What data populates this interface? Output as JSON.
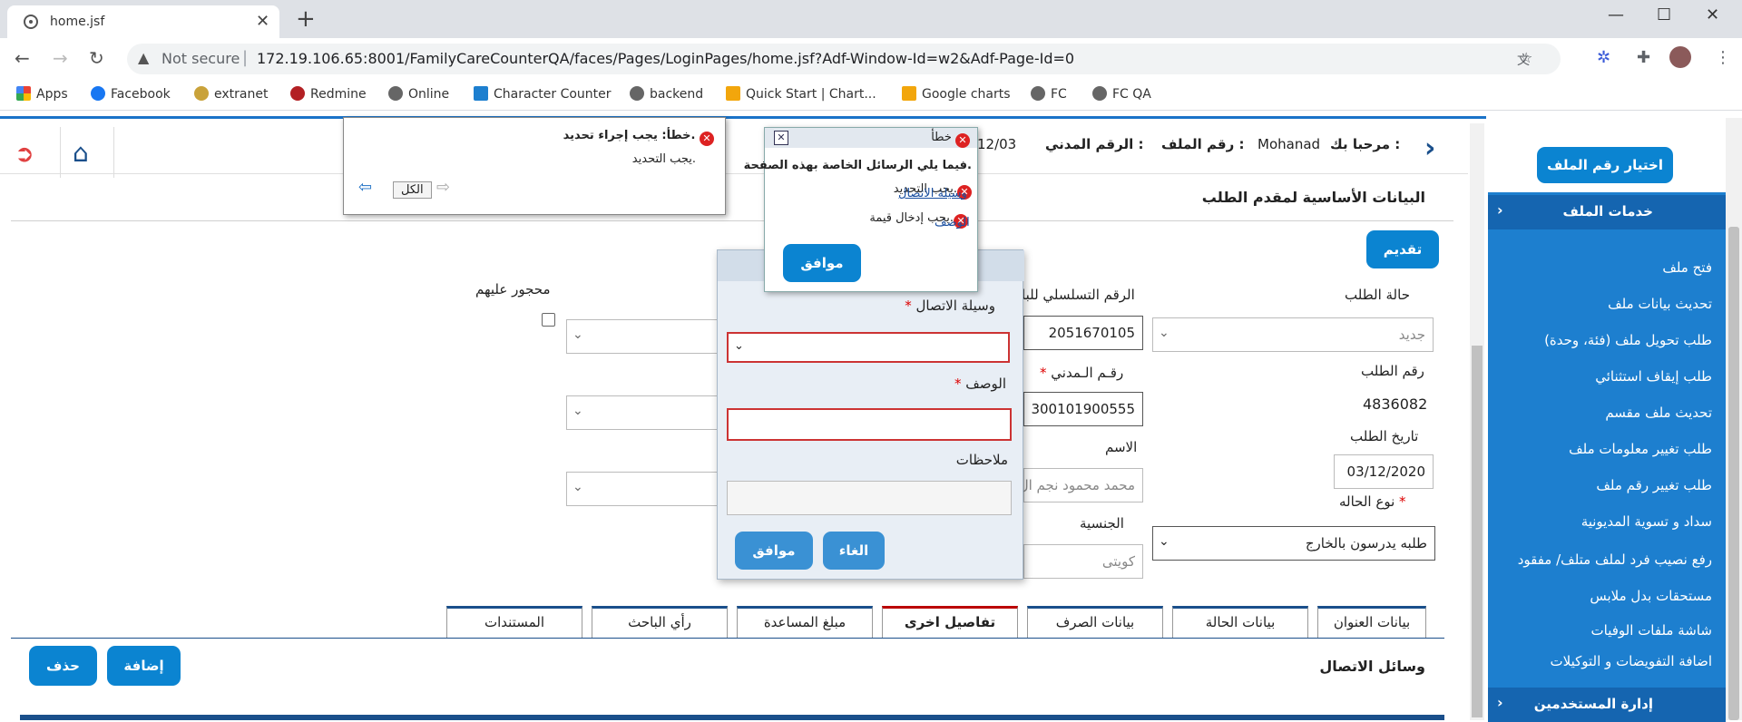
{
  "browser": {
    "tab_title": "home.jsf",
    "not_secure": "Not secure",
    "url": "172.19.106.65:8001/FamilyCareCounterQA/faces/Pages/LoginPages/home.jsf?Adf-Window-Id=w2&Adf-Page-Id=0",
    "bookmarks": [
      "Apps",
      "Facebook",
      "extranet",
      "Redmine",
      "Online",
      "Character Counter",
      "backend",
      "Quick Start | Chart...",
      "Google charts",
      "FC",
      "FC QA"
    ]
  },
  "header": {
    "welcome": "مرحبا بك :",
    "user": "Mohanad",
    "file_no_label": "رقم الملف :",
    "civil_no_label": "الرقم المدني :",
    "date_fragment": "12/03"
  },
  "sidebar": {
    "choose_file": "اختيار رقم الملف",
    "section1": "خدمات الملف",
    "items": [
      "فتح ملف",
      "تحديث بيانات ملف",
      "طلب تحويل ملف (فئة، وحدة)",
      "طلب إيقاف استثنائي",
      "تحديث ملف مقسم",
      "طلب تغيير معلومات ملف",
      "طلب تغيير رقم ملف",
      "سداد و تسوية المديونية",
      "رفع نصيب فرد لملف متلف/ مفقود",
      "مستحقات بدل ملابس",
      "شاشة ملفات الوفيات",
      "اضافة التفويضات و التوكيلات"
    ],
    "section2": "إدارة المستخدمين"
  },
  "form": {
    "title": "البيانات الأساسية لمقدم الطلب",
    "submit": "تقديم",
    "request_status_label": "حالة الطلب",
    "request_status_value": "جديد",
    "request_no_label": "رقم الطلب",
    "request_no_value": "4836082",
    "request_date_label": "تاريخ الطلب",
    "request_date_value": "03/12/2020",
    "case_type_label": "نوع الحاله",
    "case_type_value": "طلبه يدرسون بالخارج",
    "serial_label": "الرقم التسلسلي للبا",
    "serial_value": "2051670105",
    "civil_label": "رقـم الـمدني",
    "civil_value": "300101900555",
    "name_label": "الاسم",
    "name_value": "محمد محمود نجم ال",
    "nationality_label": "الجنسية",
    "nationality_value": "كويتى",
    "guardianship_label": "محجور عليهم"
  },
  "tabs": [
    "بيانات العنوان",
    "بيانات الحالة",
    "بيانات الصرف",
    "تفاصيل اخرى",
    "مبلغ المساعدة",
    "رأي الباحث",
    "المستندات"
  ],
  "contacts": {
    "title": "وسائل الاتصال",
    "add": "إضافة",
    "delete": "حذف"
  },
  "popup_left": {
    "title": "خطأ: يجب إجراء تحديد.",
    "message": "يجب التحديد.",
    "all": "الكل"
  },
  "popup_error": {
    "title": "خطأ",
    "intro": "فيما يلي الرسائل الخاصة بهذه الصفحة.",
    "link1": "وسيلة الاتصال",
    "msg1": "يجب التحديد.",
    "link2": "الوصف",
    "msg2": "يجب إدخال قيمة.",
    "ok": "موافق"
  },
  "dialog": {
    "contact_label": "وسيلة الاتصال",
    "desc_label": "الوصف",
    "notes_label": "ملاحظات",
    "cancel": "الغاء",
    "ok": "موافق"
  }
}
